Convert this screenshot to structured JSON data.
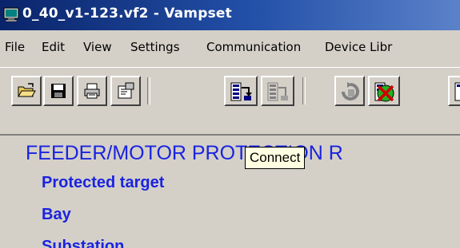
{
  "window": {
    "title": "0_40_v1-123.vf2 - Vampset",
    "app_icon": "monitor-icon"
  },
  "menu": [
    "File",
    "Edit",
    "View",
    "Settings",
    "Communication",
    "Device Libr"
  ],
  "toolbar": {
    "buttons": [
      {
        "name": "open-button",
        "icon": "folder-open-icon"
      },
      {
        "name": "save-button",
        "icon": "floppy-disk-icon"
      },
      {
        "name": "print-button",
        "icon": "printer-icon"
      },
      {
        "name": "properties-button",
        "icon": "properties-icon"
      },
      {
        "name": "connect-button",
        "icon": "connect-icon"
      },
      {
        "name": "disconnect-button",
        "icon": "disconnect-icon",
        "disabled": true
      },
      {
        "name": "refresh-button",
        "icon": "refresh-icon",
        "disabled": true
      },
      {
        "name": "stop-button",
        "icon": "stop-icon"
      },
      {
        "name": "more-button",
        "icon": "device-icon"
      }
    ],
    "tooltip": "Connect"
  },
  "content": {
    "heading": "FEEDER/MOTOR PROTECTION R",
    "fields": [
      "Protected target",
      "Bay",
      "Substation"
    ]
  },
  "colors": {
    "titlebar_start": "#0a246a",
    "titlebar_end": "#5b82c9",
    "text_blue": "#1a23e0",
    "tooltip_bg": "#ffffe1",
    "chrome": "#d4d0c8"
  }
}
